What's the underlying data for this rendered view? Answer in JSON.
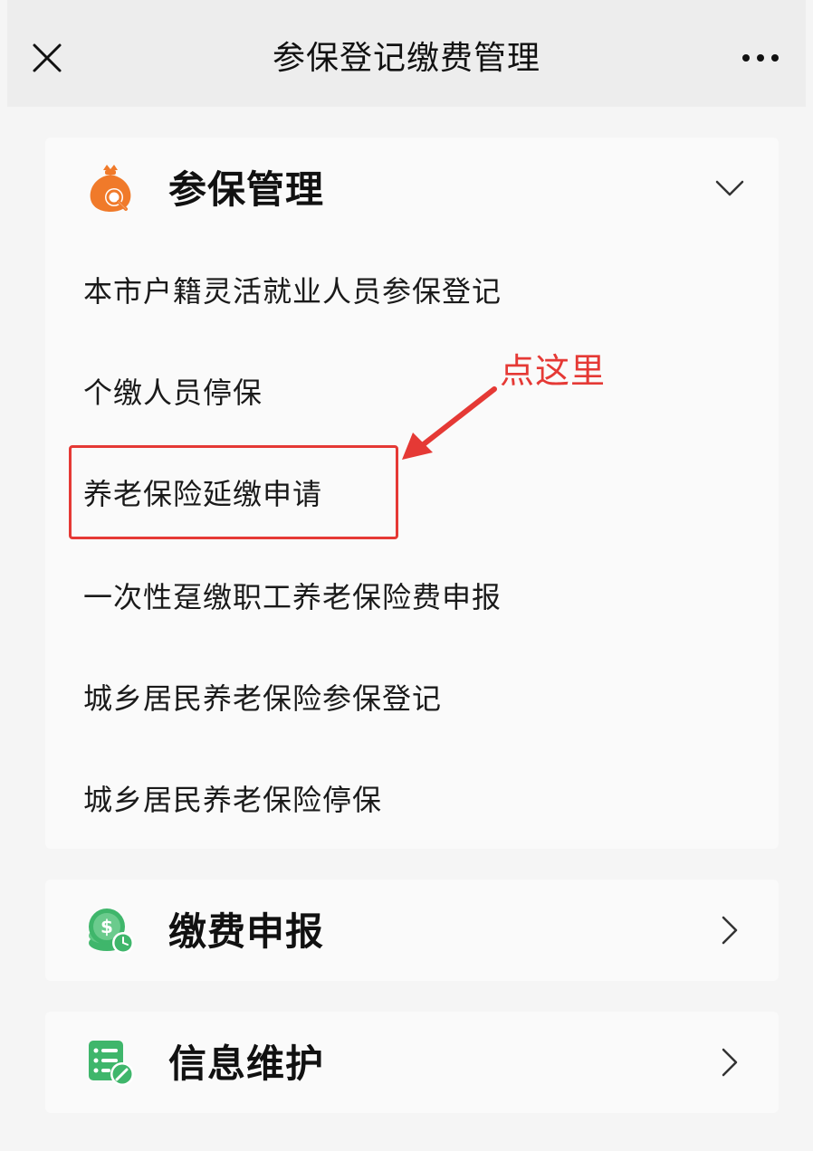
{
  "topbar": {
    "title": "参保登记缴费管理",
    "close_icon": "close-icon",
    "more_icon": "more-horizontal-icon"
  },
  "sections": [
    {
      "title": "参保管理",
      "icon": "money-bag-search-icon",
      "state": "expanded",
      "items": [
        "本市户籍灵活就业人员参保登记",
        "个缴人员停保",
        "养老保险延缴申请",
        "一次性趸缴职工养老保险费申报",
        "城乡居民养老保险参保登记",
        "城乡居民养老保险停保"
      ]
    },
    {
      "title": "缴费申报",
      "icon": "coin-clock-icon",
      "state": "collapsed"
    },
    {
      "title": "信息维护",
      "icon": "document-edit-icon",
      "state": "collapsed"
    }
  ],
  "annotation": {
    "text": "点这里",
    "color": "#e53935",
    "target_item": "养老保险延缴申请"
  },
  "colors": {
    "annotation_red": "#e53935",
    "icon_orange": "#f07a2a",
    "icon_green": "#3fb66b"
  }
}
